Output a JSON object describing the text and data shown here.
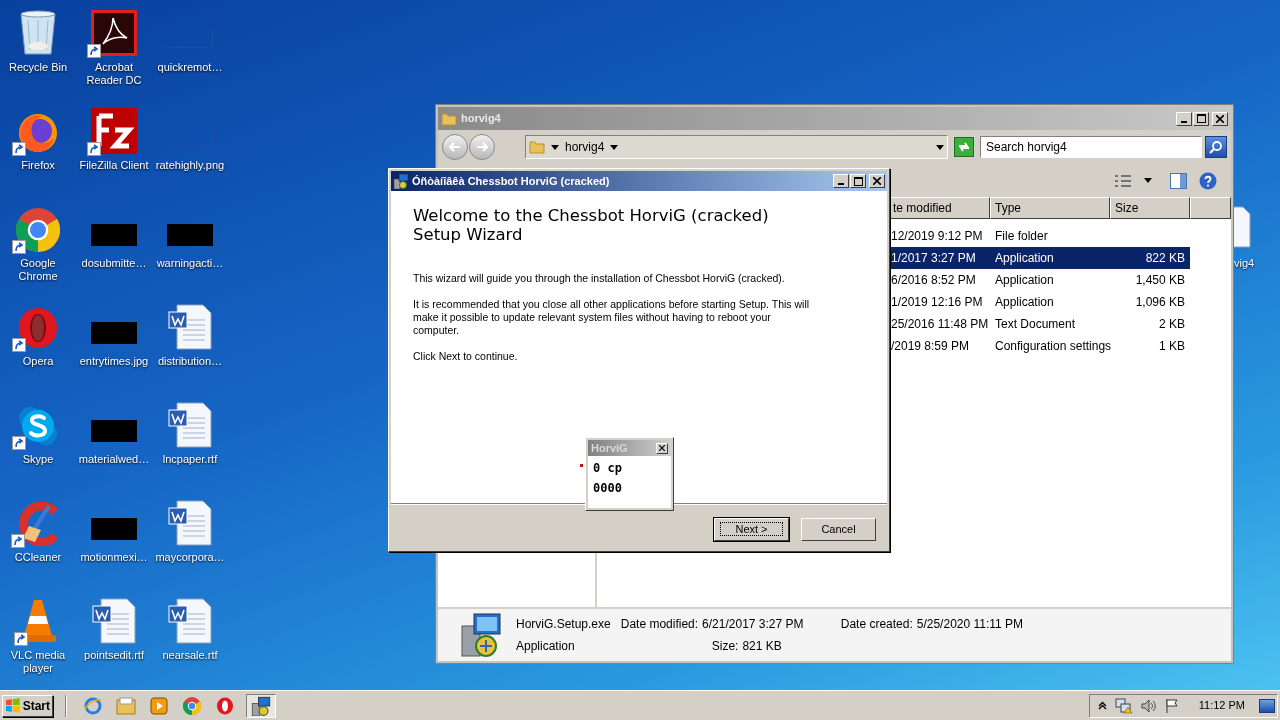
{
  "desktop": {
    "icons": [
      {
        "label": "Recycle Bin",
        "kind": "recycle",
        "shortcut": false
      },
      {
        "label": "Firefox",
        "kind": "firefox",
        "shortcut": true
      },
      {
        "label": "Google Chrome",
        "kind": "chrome",
        "shortcut": true
      },
      {
        "label": "Opera",
        "kind": "opera",
        "shortcut": true
      },
      {
        "label": "Skype",
        "kind": "skype",
        "shortcut": true
      },
      {
        "label": "CCleaner",
        "kind": "ccleaner",
        "shortcut": true
      },
      {
        "label": "VLC media player",
        "kind": "vlc",
        "shortcut": true
      },
      {
        "label": "Acrobat Reader DC",
        "kind": "acrobat",
        "shortcut": true
      },
      {
        "label": "FileZilla Client",
        "kind": "filezilla",
        "shortcut": true
      },
      {
        "label": "dosubmitte…",
        "kind": "redacted",
        "shortcut": false
      },
      {
        "label": "entrytimes.jpg",
        "kind": "redacted",
        "shortcut": false
      },
      {
        "label": "materialwed…",
        "kind": "redacted",
        "shortcut": false
      },
      {
        "label": "motionmexi…",
        "kind": "redacted",
        "shortcut": false
      },
      {
        "label": "pointsedit.rtf",
        "kind": "word",
        "shortcut": false
      },
      {
        "label": "quickremot…",
        "kind": "image",
        "shortcut": false
      },
      {
        "label": "ratehighly.png",
        "kind": "image",
        "shortcut": false
      },
      {
        "label": "warningacti…",
        "kind": "redacted",
        "shortcut": false
      },
      {
        "label": "distribution…",
        "kind": "word",
        "shortcut": false
      },
      {
        "label": "lncpaper.rtf",
        "kind": "word",
        "shortcut": false
      },
      {
        "label": "maycorpora…",
        "kind": "word",
        "shortcut": false
      },
      {
        "label": "nearsale.rtf",
        "kind": "word",
        "shortcut": false
      }
    ],
    "partial_icon": {
      "label": "vig4"
    }
  },
  "explorer": {
    "title": "horvig4",
    "address": "horvig4",
    "search": {
      "placeholder": "Search horvig4"
    },
    "columns": [
      "te modified",
      "Type",
      "Size"
    ],
    "rows": [
      {
        "date_modified": "12/2019 9:12 PM",
        "type": "File folder",
        "selected": false
      },
      {
        "date_modified": "1/2017 3:27 PM",
        "type": "Application",
        "size": "822 KB",
        "selected": true
      },
      {
        "date_modified": "6/2016 8:52 PM",
        "type": "Application",
        "size": "1,450 KB",
        "selected": false
      },
      {
        "date_modified": "1/2019 12:16 PM",
        "type": "Application",
        "size": "1,096 KB",
        "selected": false
      },
      {
        "date_modified": "25/2016 11:48 PM",
        "type": "Text Document",
        "size": "2 KB",
        "selected": false
      },
      {
        "date_modified": "/2019 8:59 PM",
        "type": "Configuration settings",
        "size": "1 KB",
        "selected": false
      }
    ],
    "details": {
      "name": "HorviG.Setup.exe",
      "type": "Application",
      "date_modified_label": "Date modified:",
      "date_modified": "6/21/2017 3:27 PM",
      "size_label": "Size:",
      "size": "821 KB",
      "date_created_label": "Date created:",
      "date_created": "5/25/2020 11:11 PM"
    }
  },
  "wizard": {
    "title": "Óñòàíîâêà Chessbot HorviG (cracked)",
    "heading": "Welcome to the Chessbot HorviG (cracked) Setup Wizard",
    "paragraphs": [
      "This wizard will guide you through the installation of Chessbot HorviG (cracked).",
      "It is recommended that you close all other applications before starting Setup. This will make it possible to update relevant system files without having to reboot your computer.",
      "Click Next to continue."
    ],
    "buttons": [
      {
        "label": "Next >",
        "default": true
      },
      {
        "label": "Cancel",
        "default": false
      }
    ]
  },
  "popup": {
    "title": "HorviG",
    "lines": [
      "0 cp",
      "0000"
    ]
  },
  "taskbar": {
    "start": "Start",
    "items": [
      {
        "kind": "ie",
        "active": false
      },
      {
        "kind": "explorer",
        "active": false
      },
      {
        "kind": "media",
        "active": false
      },
      {
        "kind": "chrome",
        "active": false
      },
      {
        "kind": "opera",
        "active": false
      },
      {
        "kind": "setup",
        "active": true
      }
    ],
    "clock": "11:12 PM"
  }
}
